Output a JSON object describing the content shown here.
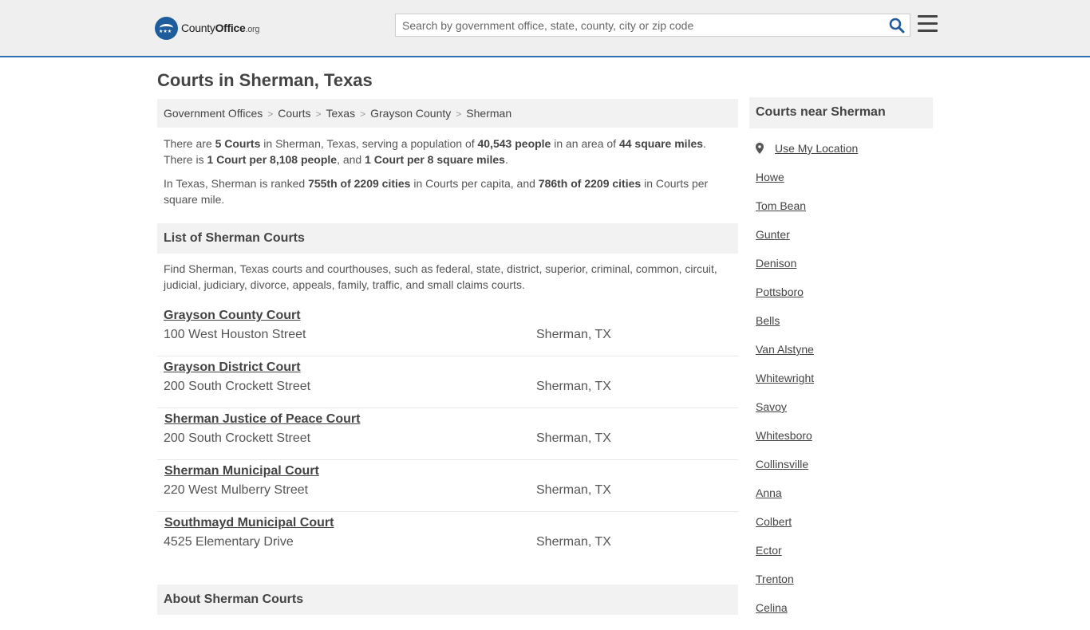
{
  "header": {
    "logo": {
      "name": "County",
      "name_bold": "Office",
      "tld": ".org"
    },
    "search_placeholder": "Search by government office, state, county, city or zip code"
  },
  "page_title": "Courts in Sherman, Texas",
  "breadcrumb": [
    "Government Offices",
    "Courts",
    "Texas",
    "Grayson County",
    "Sherman"
  ],
  "stats": {
    "p1": {
      "t1": "There are ",
      "b1": "5 Courts",
      "t2": " in Sherman, Texas, serving a population of ",
      "b2": "40,543 people",
      "t3": " in an area of ",
      "b3": "44 square miles",
      "t4": ". There is ",
      "b4": "1 Court per 8,108 people",
      "t5": ", and ",
      "b5": "1 Court per 8 square miles",
      "t6": "."
    },
    "p2": {
      "t1": "In Texas, Sherman is ranked ",
      "b1": "755th of 2209 cities",
      "t2": " in Courts per capita, and ",
      "b2": "786th of 2209 cities",
      "t3": " in Courts per square mile."
    }
  },
  "list_heading": "List of Sherman Courts",
  "list_intro": "Find Sherman, Texas courts and courthouses, such as federal, state, district, superior, criminal, common, circuit, judicial, judiciary, divorce, appeals, family, traffic, and small claims courts.",
  "courts": [
    {
      "name": "Grayson County Court",
      "address": "100 West Houston Street",
      "city": "Sherman, TX"
    },
    {
      "name": "Grayson District Court",
      "address": "200 South Crockett Street",
      "city": "Sherman, TX"
    },
    {
      "name": "Sherman Justice of Peace Court",
      "address": "200 South Crockett Street",
      "city": "Sherman, TX"
    },
    {
      "name": "Sherman Municipal Court",
      "address": "220 West Mulberry Street",
      "city": "Sherman, TX"
    },
    {
      "name": "Southmayd Municipal Court",
      "address": "4525 Elementary Drive",
      "city": "Sherman, TX"
    }
  ],
  "about_heading": "About Sherman Courts",
  "sidebar": {
    "heading": "Courts near Sherman",
    "use_location": "Use My Location",
    "cities": [
      "Howe",
      "Tom Bean",
      "Gunter",
      "Denison",
      "Pottsboro",
      "Bells",
      "Van Alstyne",
      "Whitewright",
      "Savoy",
      "Whitesboro",
      "Collinsville",
      "Anna",
      "Colbert",
      "Ector",
      "Trenton",
      "Celina"
    ]
  },
  "colors": {
    "header_bg": "#efefef",
    "accent": "#1f5c9c",
    "panel_bg": "#f2f2f2",
    "text": "#444444"
  }
}
